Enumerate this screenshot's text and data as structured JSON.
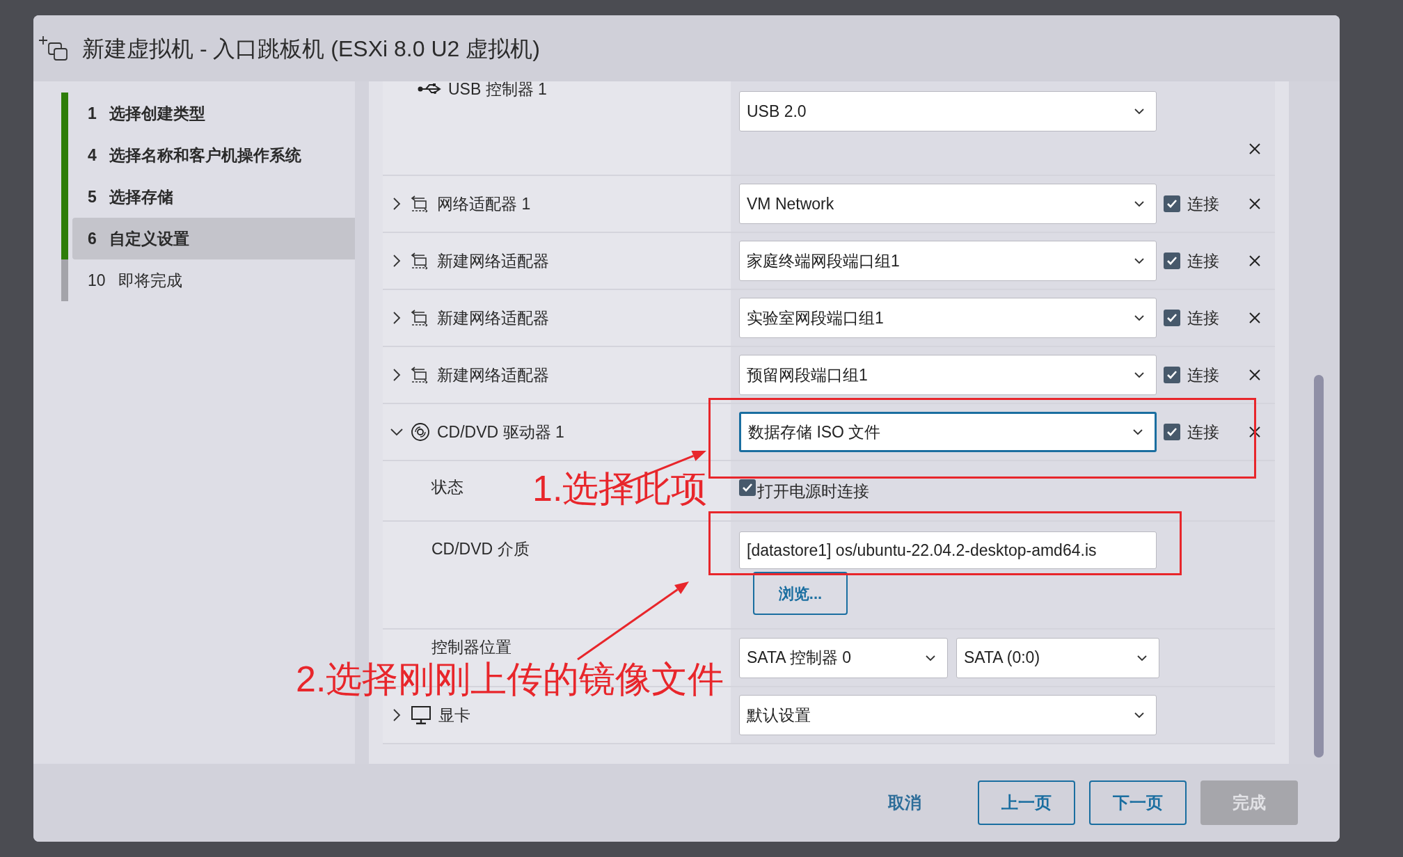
{
  "dialog": {
    "title": "新建虚拟机 - 入口跳板机 (ESXi 8.0 U2 虚拟机)",
    "steps": [
      {
        "number": "1",
        "label": "选择创建类型",
        "completed": true,
        "selected": false
      },
      {
        "number": "4",
        "label": "选择名称和客户机操作系统",
        "completed": true,
        "selected": false
      },
      {
        "number": "5",
        "label": "选择存储",
        "completed": true,
        "selected": false
      },
      {
        "number": "6",
        "label": "自定义设置",
        "completed": true,
        "selected": true
      },
      {
        "number": "10",
        "label": "即将完成",
        "completed": false,
        "selected": false
      }
    ],
    "hardware": [
      {
        "kind": "usb",
        "label": "USB 控制器 1",
        "value": "USB 2.0"
      },
      {
        "kind": "network",
        "label": "网络适配器 1",
        "expanded": false,
        "value": "VM Network",
        "connect_label": "连接",
        "connected": true
      },
      {
        "kind": "network",
        "label": "新建网络适配器",
        "expanded": false,
        "value": "家庭终端网段端口组1",
        "connect_label": "连接",
        "connected": true
      },
      {
        "kind": "network",
        "label": "新建网络适配器",
        "expanded": false,
        "value": "实验室网段端口组1",
        "connect_label": "连接",
        "connected": true
      },
      {
        "kind": "network",
        "label": "新建网络适配器",
        "expanded": false,
        "value": "预留网段端口组1",
        "connect_label": "连接",
        "connected": true
      },
      {
        "kind": "cdrom",
        "label": "CD/DVD 驱动器 1",
        "expanded": true,
        "value": "数据存储 ISO 文件",
        "connect_label": "连接",
        "connected": true,
        "details": [
          {
            "kind": "checkbox",
            "label": "状态",
            "option_label": "打开电源时连接",
            "checked": true
          },
          {
            "kind": "file",
            "label": "CD/DVD 介质",
            "value": "[datastore1] os/ubuntu-22.04.2-desktop-amd64.is",
            "button": "浏览..."
          },
          {
            "kind": "location",
            "label": "控制器位置",
            "controller": "SATA 控制器 0",
            "slot": "SATA (0:0)"
          }
        ]
      },
      {
        "kind": "display",
        "label": "显卡",
        "expanded": false,
        "value": "默认设置"
      }
    ],
    "buttons": [
      {
        "label": "取消",
        "kind": "link",
        "disabled": false
      },
      {
        "label": "上一页",
        "kind": "outline",
        "disabled": false
      },
      {
        "label": "下一页",
        "kind": "outline",
        "disabled": false
      },
      {
        "label": "完成",
        "kind": "solid",
        "disabled": true
      }
    ]
  },
  "annotations": [
    {
      "text": "1.选择此项"
    },
    {
      "text": "2.选择刚刚上传的镜像文件"
    }
  ]
}
